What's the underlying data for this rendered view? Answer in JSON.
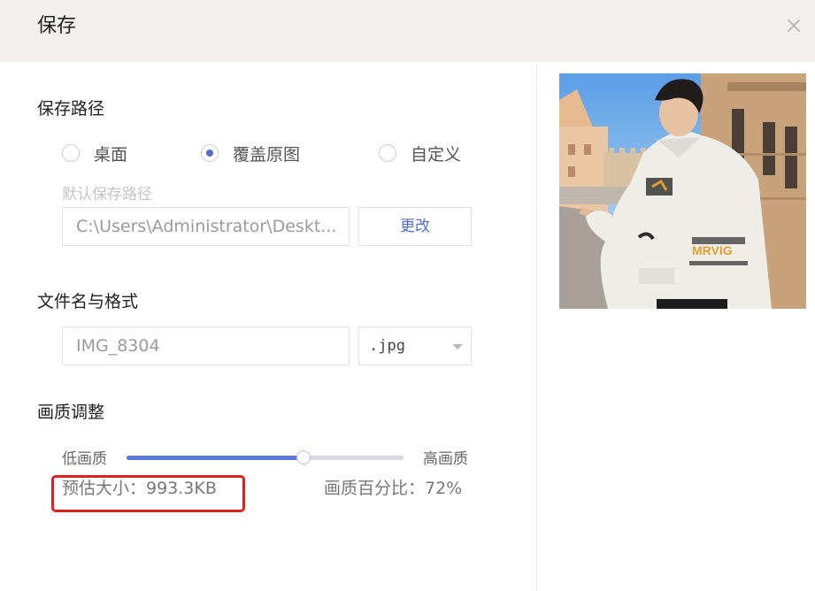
{
  "dialog": {
    "title": "保存",
    "close_icon": "close-icon"
  },
  "save_path": {
    "heading": "保存路径",
    "options": [
      {
        "label": "桌面",
        "checked": false
      },
      {
        "label": "覆盖原图",
        "checked": true
      },
      {
        "label": "自定义",
        "checked": false
      }
    ],
    "default_path_label": "默认保存路径",
    "path_value": "C:\\Users\\Administrator\\Deskt...",
    "change_button": "更改"
  },
  "file": {
    "heading": "文件名与格式",
    "filename": "IMG_8304",
    "format": ".jpg"
  },
  "quality": {
    "heading": "画质调整",
    "low_label": "低画质",
    "high_label": "高画质",
    "value_fraction": 0.64,
    "estimated_size": "预估大小：993.3KB",
    "percentage": "画质百分比：72%"
  },
  "colors": {
    "accent": "#4f6fcf",
    "slider_fill": "#5a79d8",
    "highlight_box": "#e02020",
    "titlebar_bg": "#f2efee"
  }
}
